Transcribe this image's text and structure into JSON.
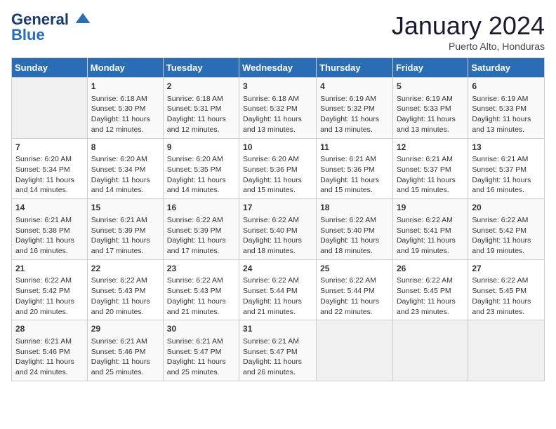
{
  "header": {
    "logo_line1": "General",
    "logo_line2": "Blue",
    "title": "January 2024",
    "subtitle": "Puerto Alto, Honduras"
  },
  "weekdays": [
    "Sunday",
    "Monday",
    "Tuesday",
    "Wednesday",
    "Thursday",
    "Friday",
    "Saturday"
  ],
  "weeks": [
    [
      {
        "day": "",
        "info": ""
      },
      {
        "day": "1",
        "info": "Sunrise: 6:18 AM\nSunset: 5:30 PM\nDaylight: 11 hours\nand 12 minutes."
      },
      {
        "day": "2",
        "info": "Sunrise: 6:18 AM\nSunset: 5:31 PM\nDaylight: 11 hours\nand 12 minutes."
      },
      {
        "day": "3",
        "info": "Sunrise: 6:18 AM\nSunset: 5:32 PM\nDaylight: 11 hours\nand 13 minutes."
      },
      {
        "day": "4",
        "info": "Sunrise: 6:19 AM\nSunset: 5:32 PM\nDaylight: 11 hours\nand 13 minutes."
      },
      {
        "day": "5",
        "info": "Sunrise: 6:19 AM\nSunset: 5:33 PM\nDaylight: 11 hours\nand 13 minutes."
      },
      {
        "day": "6",
        "info": "Sunrise: 6:19 AM\nSunset: 5:33 PM\nDaylight: 11 hours\nand 13 minutes."
      }
    ],
    [
      {
        "day": "7",
        "info": "Sunrise: 6:20 AM\nSunset: 5:34 PM\nDaylight: 11 hours\nand 14 minutes."
      },
      {
        "day": "8",
        "info": "Sunrise: 6:20 AM\nSunset: 5:34 PM\nDaylight: 11 hours\nand 14 minutes."
      },
      {
        "day": "9",
        "info": "Sunrise: 6:20 AM\nSunset: 5:35 PM\nDaylight: 11 hours\nand 14 minutes."
      },
      {
        "day": "10",
        "info": "Sunrise: 6:20 AM\nSunset: 5:36 PM\nDaylight: 11 hours\nand 15 minutes."
      },
      {
        "day": "11",
        "info": "Sunrise: 6:21 AM\nSunset: 5:36 PM\nDaylight: 11 hours\nand 15 minutes."
      },
      {
        "day": "12",
        "info": "Sunrise: 6:21 AM\nSunset: 5:37 PM\nDaylight: 11 hours\nand 15 minutes."
      },
      {
        "day": "13",
        "info": "Sunrise: 6:21 AM\nSunset: 5:37 PM\nDaylight: 11 hours\nand 16 minutes."
      }
    ],
    [
      {
        "day": "14",
        "info": "Sunrise: 6:21 AM\nSunset: 5:38 PM\nDaylight: 11 hours\nand 16 minutes."
      },
      {
        "day": "15",
        "info": "Sunrise: 6:21 AM\nSunset: 5:39 PM\nDaylight: 11 hours\nand 17 minutes."
      },
      {
        "day": "16",
        "info": "Sunrise: 6:22 AM\nSunset: 5:39 PM\nDaylight: 11 hours\nand 17 minutes."
      },
      {
        "day": "17",
        "info": "Sunrise: 6:22 AM\nSunset: 5:40 PM\nDaylight: 11 hours\nand 18 minutes."
      },
      {
        "day": "18",
        "info": "Sunrise: 6:22 AM\nSunset: 5:40 PM\nDaylight: 11 hours\nand 18 minutes."
      },
      {
        "day": "19",
        "info": "Sunrise: 6:22 AM\nSunset: 5:41 PM\nDaylight: 11 hours\nand 19 minutes."
      },
      {
        "day": "20",
        "info": "Sunrise: 6:22 AM\nSunset: 5:42 PM\nDaylight: 11 hours\nand 19 minutes."
      }
    ],
    [
      {
        "day": "21",
        "info": "Sunrise: 6:22 AM\nSunset: 5:42 PM\nDaylight: 11 hours\nand 20 minutes."
      },
      {
        "day": "22",
        "info": "Sunrise: 6:22 AM\nSunset: 5:43 PM\nDaylight: 11 hours\nand 20 minutes."
      },
      {
        "day": "23",
        "info": "Sunrise: 6:22 AM\nSunset: 5:43 PM\nDaylight: 11 hours\nand 21 minutes."
      },
      {
        "day": "24",
        "info": "Sunrise: 6:22 AM\nSunset: 5:44 PM\nDaylight: 11 hours\nand 21 minutes."
      },
      {
        "day": "25",
        "info": "Sunrise: 6:22 AM\nSunset: 5:44 PM\nDaylight: 11 hours\nand 22 minutes."
      },
      {
        "day": "26",
        "info": "Sunrise: 6:22 AM\nSunset: 5:45 PM\nDaylight: 11 hours\nand 23 minutes."
      },
      {
        "day": "27",
        "info": "Sunrise: 6:22 AM\nSunset: 5:45 PM\nDaylight: 11 hours\nand 23 minutes."
      }
    ],
    [
      {
        "day": "28",
        "info": "Sunrise: 6:21 AM\nSunset: 5:46 PM\nDaylight: 11 hours\nand 24 minutes."
      },
      {
        "day": "29",
        "info": "Sunrise: 6:21 AM\nSunset: 5:46 PM\nDaylight: 11 hours\nand 25 minutes."
      },
      {
        "day": "30",
        "info": "Sunrise: 6:21 AM\nSunset: 5:47 PM\nDaylight: 11 hours\nand 25 minutes."
      },
      {
        "day": "31",
        "info": "Sunrise: 6:21 AM\nSunset: 5:47 PM\nDaylight: 11 hours\nand 26 minutes."
      },
      {
        "day": "",
        "info": ""
      },
      {
        "day": "",
        "info": ""
      },
      {
        "day": "",
        "info": ""
      }
    ]
  ]
}
